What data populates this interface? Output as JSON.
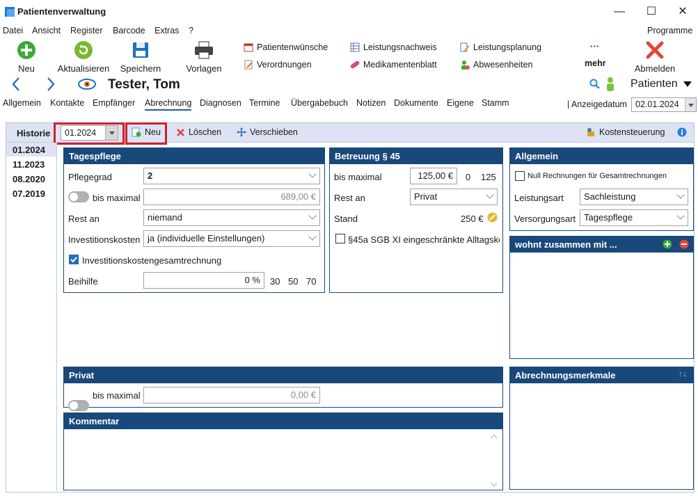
{
  "window": {
    "title": "Patientenverwaltung",
    "minimize": "—",
    "maximize": "☐",
    "close": "✕"
  },
  "menu": [
    "Datei",
    "Ansicht",
    "Register",
    "Barcode",
    "Extras",
    "?"
  ],
  "menu_right": "Programme",
  "toolbar": {
    "neu": "Neu",
    "aktualisieren": "Aktualisieren",
    "speichern": "Speichern",
    "vorlagen": "Vorlagen",
    "patientenwuensche": "Patientenwünsche",
    "verordnungen": "Verordnungen",
    "leistungsnachweis": "Leistungsnachweis",
    "medikamentenblatt": "Medikamentenblatt",
    "leistungsplanung": "Leistungsplanung",
    "abwesenheiten": "Abwesenheiten",
    "mehr": "mehr",
    "abmelden": "Abmelden",
    "more_dots": "•••"
  },
  "patient": {
    "name": "Tester, Tom",
    "selector": "Patienten"
  },
  "tabs": [
    "Allgemein",
    "Kontakte",
    "Empfänger",
    "Abrechnung",
    "Diagnosen",
    "Termine",
    "Übergabebuch",
    "Notizen",
    "Dokumente",
    "Eigene",
    "Stamm"
  ],
  "active_tab": "Abrechnung",
  "anzeigedatum": {
    "label": "Anzeigedatum",
    "value": "02.01.2024",
    "sep": "|"
  },
  "historie": {
    "label": "Historie",
    "selected": "01.2024",
    "neu": "Neu",
    "loeschen": "Löschen",
    "verschieben": "Verschieben",
    "kostensteuerung": "Kostensteuerung",
    "items": [
      "01.2024",
      "11.2023",
      "08.2020",
      "07.2019"
    ]
  },
  "tagespflege": {
    "title": "Tagespflege",
    "pflegegrad_label": "Pflegegrad",
    "pflegegrad": "2",
    "bis_maximal_label": "bis maximal",
    "bis_maximal": "689,00 €",
    "rest_an_label": "Rest an",
    "rest_an": "niemand",
    "investitionskosten_label": "Investitionskosten",
    "investitionskosten": "ja (individuelle Einstellungen)",
    "investitionskostengesamtrechnung": "Investitionskostengesamtrechnung",
    "beihilfe_label": "Beihilfe",
    "beihilfe": "0 %",
    "beihilfe_quick": [
      "30",
      "50",
      "70"
    ]
  },
  "betreuung": {
    "title": "Betreuung § 45",
    "bis_maximal_label": "bis maximal",
    "bis_maximal": "125,00 €",
    "q1": "0",
    "q2": "125",
    "rest_an_label": "Rest an",
    "rest_an": "Privat",
    "stand_label": "Stand",
    "stand": "250 €",
    "check45a": "§45a SGB XI eingeschränkte Alltagsko"
  },
  "allgemein": {
    "title": "Allgemein",
    "null_rechnungen": "Null Rechnungen für Gesamtrechnungen",
    "leistungsart_label": "Leistungsart",
    "leistungsart": "Sachleistung",
    "versorgungsart_label": "Versorgungsart",
    "versorgungsart": "Tagespflege"
  },
  "wohnt": {
    "title": "wohnt zusammen mit ..."
  },
  "abrechnungsmerkmale": {
    "title": "Abrechnungsmerkmale",
    "sort": "↑↓"
  },
  "privat": {
    "title": "Privat",
    "bis_maximal_label": "bis maximal",
    "bis_maximal": "0,00 €"
  },
  "kommentar": {
    "title": "Kommentar"
  },
  "colors": {
    "panel_header": "#19487a",
    "accent": "#1e5f9e",
    "highlight": "#d11f2b"
  }
}
